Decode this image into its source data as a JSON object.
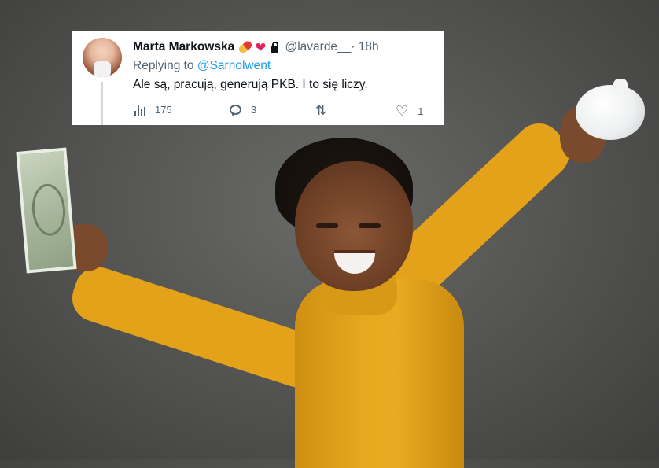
{
  "tweet": {
    "author_name": "Marta Markowska",
    "name_emojis": [
      "pill-icon",
      "red-heart-icon"
    ],
    "locked": true,
    "handle": "@lavarde__",
    "time": " · 18h",
    "replying_prefix": "Replying to ",
    "replying_to": "@Sarnolwent",
    "text": "Ale są, pracują, generują PKB. I to się liczy.",
    "stats": {
      "views": "175",
      "replies": "3",
      "retweets": "",
      "likes": "1"
    }
  },
  "photo": {
    "description_icons": [
      "dollar-bill",
      "piggy-bank",
      "child"
    ],
    "colors": {
      "background": "#565654",
      "sweater": "#e3a21a",
      "mention": "#1d9bf0"
    }
  }
}
